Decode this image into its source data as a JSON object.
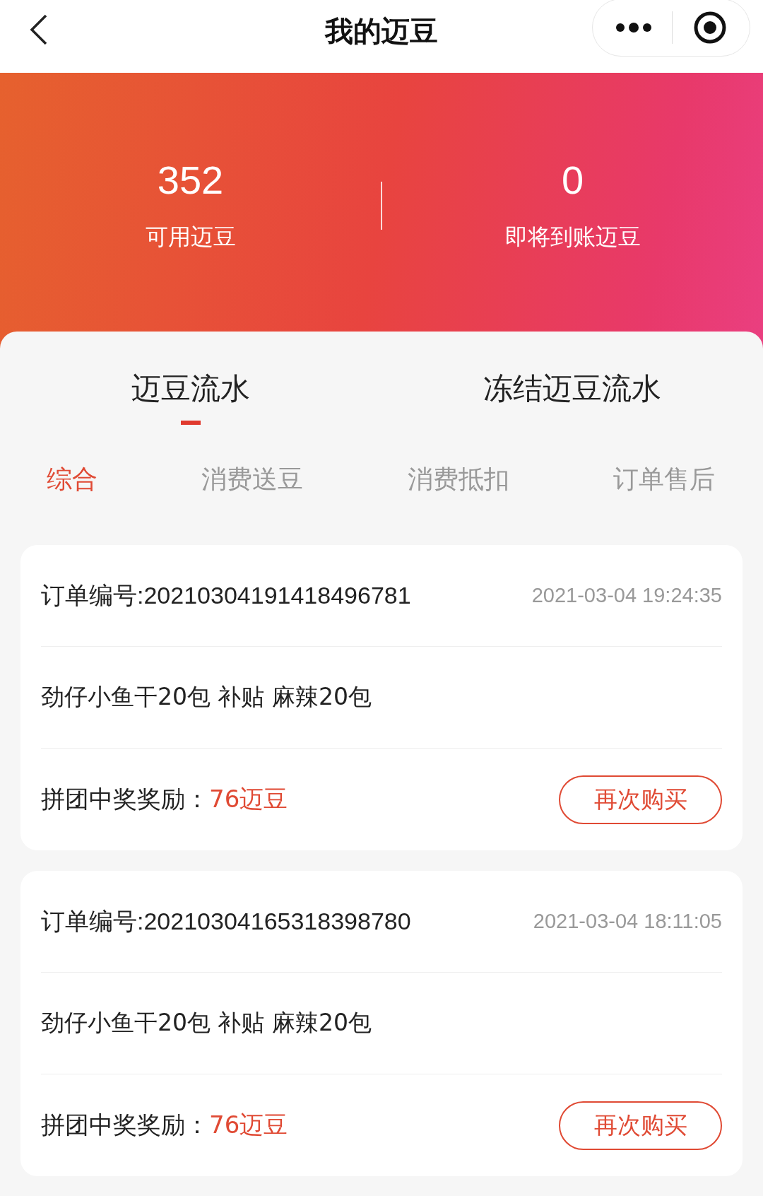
{
  "header": {
    "title": "我的迈豆"
  },
  "summary": [
    {
      "value": "352",
      "label": "可用迈豆"
    },
    {
      "value": "0",
      "label": "即将到账迈豆"
    }
  ],
  "tabs": [
    {
      "label": "迈豆流水",
      "selected": true
    },
    {
      "label": "冻结迈豆流水",
      "selected": false
    }
  ],
  "filters": [
    {
      "label": "综合",
      "selected": true
    },
    {
      "label": "消费送豆",
      "selected": false
    },
    {
      "label": "消费抵扣",
      "selected": false
    },
    {
      "label": "订单售后",
      "selected": false
    }
  ],
  "records": [
    {
      "order": "订单编号:20210304191418496781",
      "time": "2021-03-04 19:24:35",
      "product": "劲仔小鱼干20包 补贴 麻辣20包",
      "reward_label": "拼团中奖奖励：",
      "reward": "76迈豆",
      "button": "再次购买"
    },
    {
      "order": "订单编号:20210304165318398780",
      "time": "2021-03-04 18:11:05",
      "product": "劲仔小鱼干20包 补贴 麻辣20包",
      "reward_label": "拼团中奖奖励：",
      "reward": "76迈豆",
      "button": "再次购买"
    }
  ]
}
